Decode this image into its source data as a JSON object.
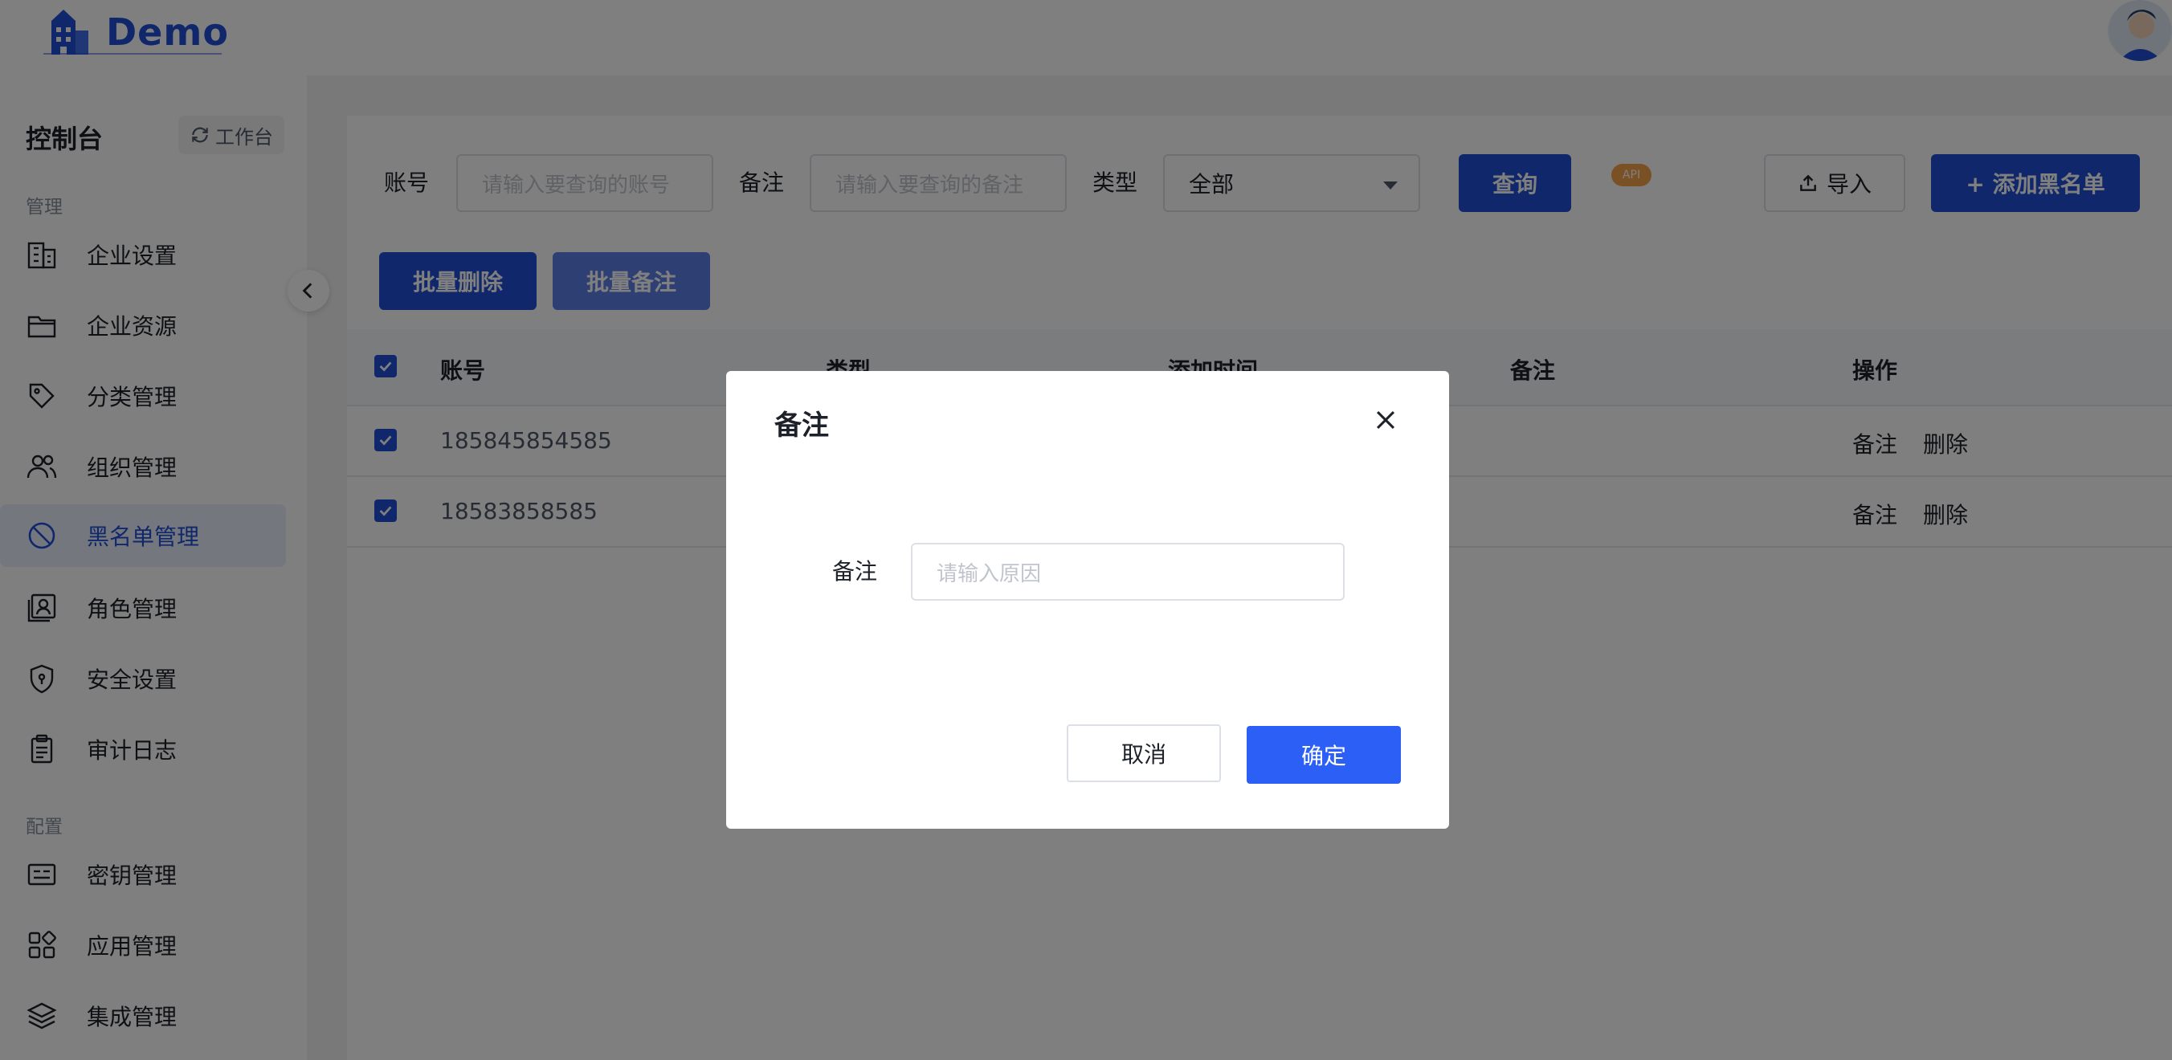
{
  "header": {
    "logo_text": "Demo",
    "brand_color": "#2150d6"
  },
  "sidebar": {
    "title": "控制台",
    "workbench_label": "工作台",
    "section_manage": "管理",
    "section_config": "配置",
    "items": [
      {
        "label": "企业设置",
        "icon": "building-icon"
      },
      {
        "label": "企业资源",
        "icon": "folder-icon"
      },
      {
        "label": "分类管理",
        "icon": "tag-icon"
      },
      {
        "label": "组织管理",
        "icon": "users-icon"
      },
      {
        "label": "黑名单管理",
        "icon": "block-icon",
        "active": true
      },
      {
        "label": "角色管理",
        "icon": "role-card-icon"
      },
      {
        "label": "安全设置",
        "icon": "shield-icon"
      },
      {
        "label": "审计日志",
        "icon": "clipboard-icon"
      }
    ],
    "config_items": [
      {
        "label": "密钥管理",
        "icon": "key-card-icon"
      },
      {
        "label": "应用管理",
        "icon": "apps-icon"
      },
      {
        "label": "集成管理",
        "icon": "layers-icon"
      }
    ]
  },
  "filters": {
    "account_label": "账号",
    "account_placeholder": "请输入要查询的账号",
    "remark_label": "备注",
    "remark_placeholder": "请输入要查询的备注",
    "type_label": "类型",
    "type_value": "全部",
    "query_label": "查询",
    "api_badge": "API",
    "import_label": "导入",
    "add_label": "+ 添加黑名单"
  },
  "batch": {
    "delete_label": "批量删除",
    "remark_label": "批量备注"
  },
  "table": {
    "columns": [
      "账号",
      "类型",
      "添加时间",
      "备注",
      "操作"
    ],
    "rows": [
      {
        "account": "185845854585",
        "ops": [
          "备注",
          "删除"
        ]
      },
      {
        "account": "18583858585",
        "ops": [
          "备注",
          "删除"
        ]
      }
    ]
  },
  "modal": {
    "title": "备注",
    "field_label": "备注",
    "field_placeholder": "请输入原因",
    "cancel_label": "取消",
    "ok_label": "确定"
  }
}
